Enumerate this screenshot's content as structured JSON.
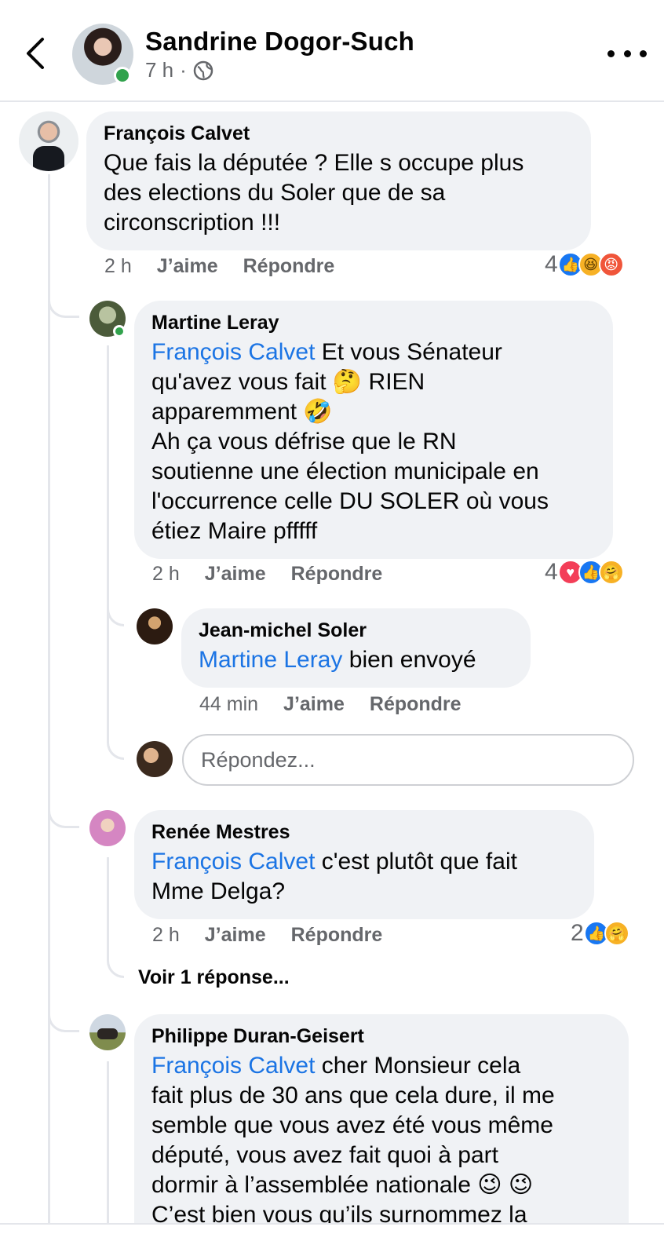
{
  "header": {
    "name": "Sandrine Dogor-Such",
    "time": "7 h",
    "separator": "·"
  },
  "comments": [
    {
      "author": "François Calvet",
      "text": "Que fais la députée ? Elle s occupe plus\ndes elections du Soler que de sa\ncirconscription !!!",
      "time": "2 h",
      "like": "J’aime",
      "reply": "Répondre",
      "reaction_count": "4",
      "reactions": [
        "like-icon",
        "haha-icon",
        "angry-icon"
      ]
    },
    {
      "author": "Martine Leray",
      "mention": "François Calvet",
      "text": " Et vous Sénateur\nqu'avez vous fait 🤔 RIEN\napparemment 🤣\nAh ça vous défrise que le RN\nsoutienne une élection municipale en\nl'occurrence celle DU SOLER où vous\nétiez Maire pfffff",
      "time": "2 h",
      "like": "J’aime",
      "reply": "Répondre",
      "reaction_count": "4",
      "reactions": [
        "love-icon",
        "like-icon",
        "care-icon"
      ]
    },
    {
      "author": "Jean-michel Soler",
      "mention": "Martine Leray",
      "text": " bien envoyé",
      "time": "44 min",
      "like": "J’aime",
      "reply": "Répondre"
    },
    {
      "author": "Renée Mestres",
      "mention": "François Calvet",
      "text": " c'est plutôt que fait\nMme Delga?",
      "time": "2 h",
      "like": "J’aime",
      "reply": "Répondre",
      "reaction_count": "2",
      "reactions": [
        "like-icon",
        "care-icon"
      ]
    },
    {
      "author": "Philippe Duran-Geisert",
      "mention": "François Calvet",
      "text": " cher Monsieur cela\nfait plus de 30 ans que cela dure, il me\nsemble que vous avez été vous même\ndéputé, vous avez fait quoi à part\ndormir à l’assemblée nationale 😉 😉\nC’est bien vous qu’ils surnommez la"
    }
  ],
  "reply_box": {
    "placeholder": "Répondez..."
  },
  "view_replies": "Voir 1 réponse...",
  "colors": {
    "mention": "#1b74e4",
    "online": "#31a24c",
    "bubble": "#f0f2f5",
    "meta": "#65676b"
  }
}
